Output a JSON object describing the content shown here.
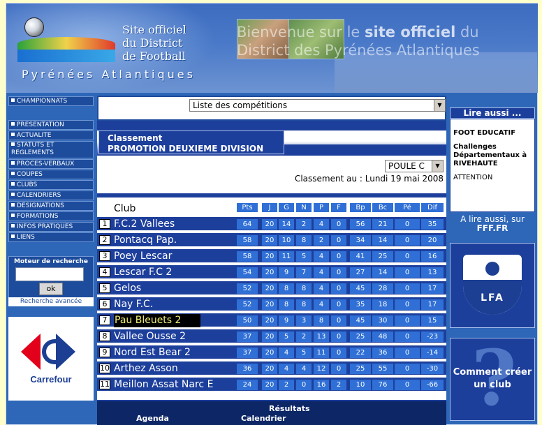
{
  "header": {
    "title_line1": "Site officiel",
    "title_line2": "du District",
    "title_line3": "de Football",
    "subtitle": "Pyrénées Atlantiques",
    "welcome_line1_pre": "Bienvenue sur le",
    "welcome_line1_bold": "site officiel",
    "welcome_line1_post": "du",
    "welcome_line2": "District des Pyrénées Atlantiques"
  },
  "sidebar": {
    "champ": "CHAMPIONNATS",
    "items": [
      "PRESENTATION",
      "ACTUALITE",
      "STATUTS ET REGLEMENTS",
      "PROCES-VERBAUX",
      "COUPES",
      "CLUBS",
      "CALENDRIERS",
      "DESIGNATIONS",
      "FORMATIONS",
      "INFOS PRATIQUES",
      "LIENS"
    ],
    "search_title": "Moteur de recherche",
    "search_button": "ok",
    "advanced_search": "Recherche avancée",
    "sponsor": "Carrefour"
  },
  "main": {
    "competition_select": "Liste des compétitions",
    "classement_label": "Classement",
    "division": "PROMOTION DEUXIEME DIVISION",
    "poule_select": "POULE C",
    "date_label": "Classement au : Lundi 19 mai 2008",
    "table": {
      "club_header": "Club",
      "columns": [
        "Pts",
        "J",
        "G",
        "N",
        "P",
        "F",
        "Bp",
        "Bc",
        "Pé",
        "Dif"
      ],
      "rows": [
        {
          "rank": "1",
          "club": "F.C.2 Vallees",
          "values": [
            "64",
            "20",
            "14",
            "2",
            "4",
            "0",
            "56",
            "21",
            "0",
            "35"
          ]
        },
        {
          "rank": "2",
          "club": "Pontacq Pap.",
          "values": [
            "58",
            "20",
            "10",
            "8",
            "2",
            "0",
            "34",
            "14",
            "0",
            "20"
          ]
        },
        {
          "rank": "3",
          "club": "Poey Lescar",
          "values": [
            "58",
            "20",
            "11",
            "5",
            "4",
            "0",
            "41",
            "25",
            "0",
            "16"
          ]
        },
        {
          "rank": "4",
          "club": "Lescar F.C 2",
          "values": [
            "54",
            "20",
            "9",
            "7",
            "4",
            "0",
            "27",
            "14",
            "0",
            "13"
          ]
        },
        {
          "rank": "5",
          "club": "Gelos",
          "values": [
            "52",
            "20",
            "8",
            "8",
            "4",
            "0",
            "45",
            "28",
            "0",
            "17"
          ]
        },
        {
          "rank": "6",
          "club": "Nay F.C.",
          "values": [
            "52",
            "20",
            "8",
            "8",
            "4",
            "0",
            "35",
            "18",
            "0",
            "17"
          ]
        },
        {
          "rank": "7",
          "club": "Pau Bleuets 2",
          "values": [
            "50",
            "20",
            "9",
            "3",
            "8",
            "0",
            "45",
            "30",
            "0",
            "15"
          ],
          "highlight": true
        },
        {
          "rank": "8",
          "club": "Vallee Ousse 2",
          "values": [
            "37",
            "20",
            "5",
            "2",
            "13",
            "0",
            "25",
            "48",
            "0",
            "-23"
          ]
        },
        {
          "rank": "9",
          "club": "Nord Est Bear 2",
          "values": [
            "37",
            "20",
            "4",
            "5",
            "11",
            "0",
            "22",
            "36",
            "0",
            "-14"
          ]
        },
        {
          "rank": "10",
          "club": "Arthez Asson",
          "values": [
            "36",
            "20",
            "4",
            "4",
            "12",
            "0",
            "25",
            "55",
            "0",
            "-30"
          ]
        },
        {
          "rank": "11",
          "club": "Meillon Assat Narc E",
          "values": [
            "24",
            "20",
            "2",
            "0",
            "16",
            "2",
            "10",
            "76",
            "0",
            "-66"
          ]
        }
      ],
      "last_row_wrap": "3"
    },
    "footer": {
      "results": "Résultats",
      "agenda": "Agenda",
      "calendar": "Calendrier"
    }
  },
  "rightcol": {
    "lire_aussi": "Lire aussi ...",
    "items": [
      "FOOT EDUCATIF",
      "Challenges Départementaux à RIVEHAUTE",
      "ATTENTION"
    ],
    "fff_line1": "A lire aussi, sur",
    "fff_line2": "FFF.FR",
    "lfa_text": "LFA",
    "club_line1": "Comment créer",
    "club_line2": "un club",
    "q_mark": "?"
  }
}
